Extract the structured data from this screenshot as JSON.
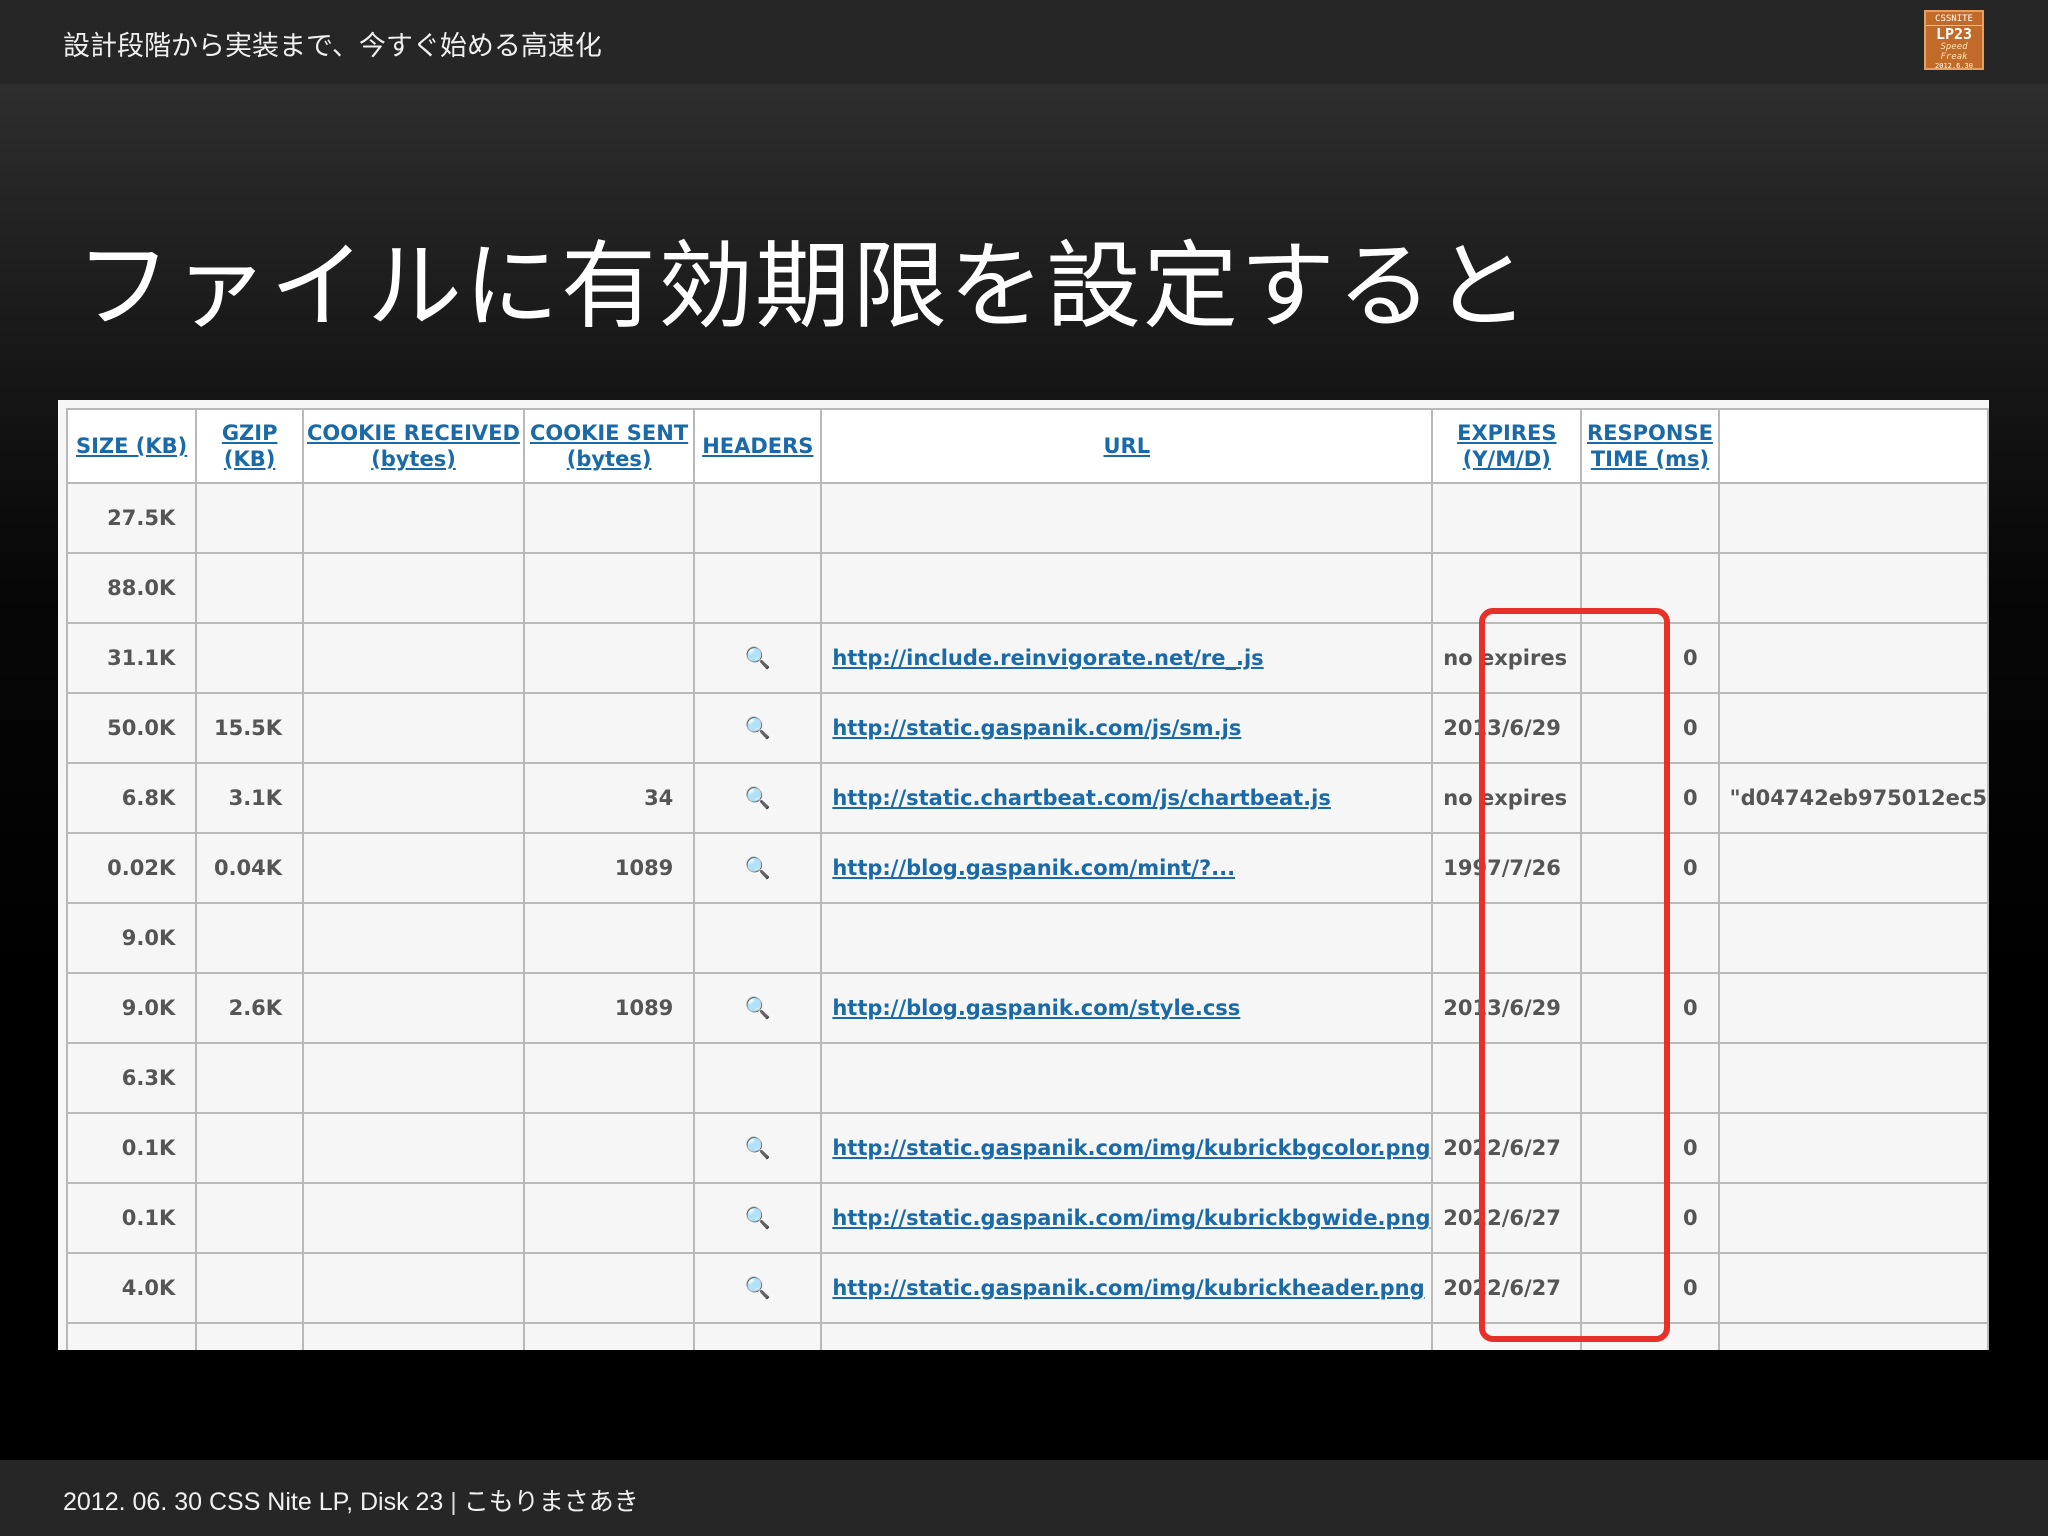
{
  "header": {
    "title": "設計段階から実装まで、今すぐ始める高速化",
    "logo": {
      "line1": "CSSNITE",
      "line2": "LP23",
      "line3": "Speed Freak",
      "line4": "2012.6.30"
    }
  },
  "slide": {
    "title": "ファイルに有効期限を設定すると"
  },
  "table": {
    "headers": [
      "SIZE (KB)",
      "GZIP (KB)",
      "COOKIE RECEIVED (bytes)",
      "COOKIE SENT (bytes)",
      "HEADERS",
      "URL",
      "EXPIRES (Y/M/D)",
      "RESPONSE TIME (ms)",
      ""
    ],
    "rows": [
      {
        "size": "27.5K",
        "gzip": "",
        "cookie_received": "",
        "cookie_sent": "",
        "headers": "",
        "url": "",
        "expires": "",
        "response": "",
        "extra": ""
      },
      {
        "size": "88.0K",
        "gzip": "",
        "cookie_received": "",
        "cookie_sent": "",
        "headers": "",
        "url": "",
        "expires": "",
        "response": "",
        "extra": ""
      },
      {
        "size": "31.1K",
        "gzip": "",
        "cookie_received": "",
        "cookie_sent": "",
        "headers": "🔍",
        "url": "http://include.reinvigorate.net/re_.js",
        "expires": "no expires",
        "response": "0",
        "extra": ""
      },
      {
        "size": "50.0K",
        "gzip": "15.5K",
        "cookie_received": "",
        "cookie_sent": "",
        "headers": "🔍",
        "url": "http://static.gaspanik.com/js/sm.js",
        "expires": "2013/6/29",
        "response": "0",
        "extra": ""
      },
      {
        "size": "6.8K",
        "gzip": "3.1K",
        "cookie_received": "",
        "cookie_sent": "34",
        "headers": "🔍",
        "url": "http://static.chartbeat.com/js/chartbeat.js",
        "expires": "no expires",
        "response": "0",
        "extra": "\"d04742eb975012ec5"
      },
      {
        "size": "0.02K",
        "gzip": "0.04K",
        "cookie_received": "",
        "cookie_sent": "1089",
        "headers": "🔍",
        "url": "http://blog.gaspanik.com/mint/?...",
        "expires": "1997/7/26",
        "response": "0",
        "extra": ""
      },
      {
        "size": "9.0K",
        "gzip": "",
        "cookie_received": "",
        "cookie_sent": "",
        "headers": "",
        "url": "",
        "expires": "",
        "response": "",
        "extra": ""
      },
      {
        "size": "9.0K",
        "gzip": "2.6K",
        "cookie_received": "",
        "cookie_sent": "1089",
        "headers": "🔍",
        "url": "http://blog.gaspanik.com/style.css",
        "expires": "2013/6/29",
        "response": "0",
        "extra": ""
      },
      {
        "size": "6.3K",
        "gzip": "",
        "cookie_received": "",
        "cookie_sent": "",
        "headers": "",
        "url": "",
        "expires": "",
        "response": "",
        "extra": ""
      },
      {
        "size": "0.1K",
        "gzip": "",
        "cookie_received": "",
        "cookie_sent": "",
        "headers": "🔍",
        "url": "http://static.gaspanik.com/img/kubrickbgcolor.png",
        "expires": "2022/6/27",
        "response": "0",
        "extra": ""
      },
      {
        "size": "0.1K",
        "gzip": "",
        "cookie_received": "",
        "cookie_sent": "",
        "headers": "🔍",
        "url": "http://static.gaspanik.com/img/kubrickbgwide.png",
        "expires": "2022/6/27",
        "response": "0",
        "extra": ""
      },
      {
        "size": "4.0K",
        "gzip": "",
        "cookie_received": "",
        "cookie_sent": "",
        "headers": "🔍",
        "url": "http://static.gaspanik.com/img/kubrickheader.png",
        "expires": "2022/6/27",
        "response": "0",
        "extra": ""
      },
      {
        "size": "",
        "gzip": "",
        "cookie_received": "",
        "cookie_sent": "",
        "headers": "",
        "url": "",
        "expires": "",
        "response": "",
        "extra": ""
      }
    ]
  },
  "highlight": {
    "color": "#e8302a",
    "target": "EXPIRES (Y/M/D)"
  },
  "footer": {
    "text": "2012. 06. 30 CSS Nite LP, Disk 23",
    "separator": "|",
    "author": "こもりまさあき"
  },
  "colors": {
    "link": "#1a6aa8",
    "topbar": "#262626",
    "highlight": "#e8302a"
  }
}
